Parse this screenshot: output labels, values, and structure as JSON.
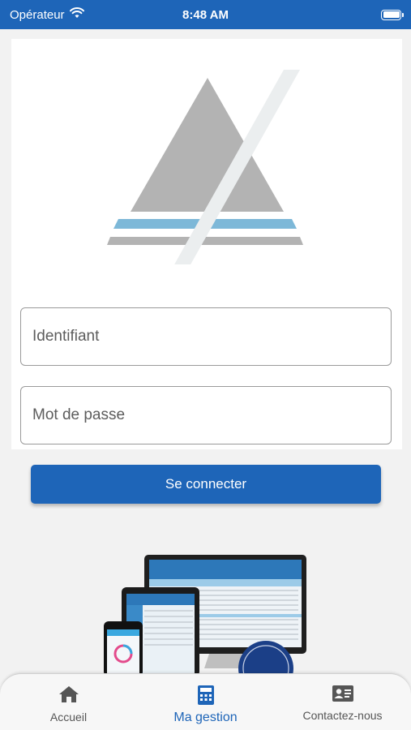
{
  "status_bar": {
    "carrier": "Opérateur",
    "time": "8:48 AM",
    "battery_level": 1.0
  },
  "login": {
    "username_placeholder": "Identifiant",
    "password_placeholder": "Mot de passe",
    "submit_label": "Se connecter"
  },
  "tab_bar": {
    "items": [
      {
        "label": "Accueil",
        "icon": "home-icon",
        "active": false
      },
      {
        "label": "Ma gestion",
        "icon": "calculator-icon",
        "active": true
      },
      {
        "label": "Contactez-nous",
        "icon": "contact-card-icon",
        "active": false
      }
    ]
  },
  "colors": {
    "primary": "#1e65b8",
    "logo_gray": "#b3b3b3",
    "logo_blue": "#7db8d8",
    "tab_inactive": "#555555"
  }
}
